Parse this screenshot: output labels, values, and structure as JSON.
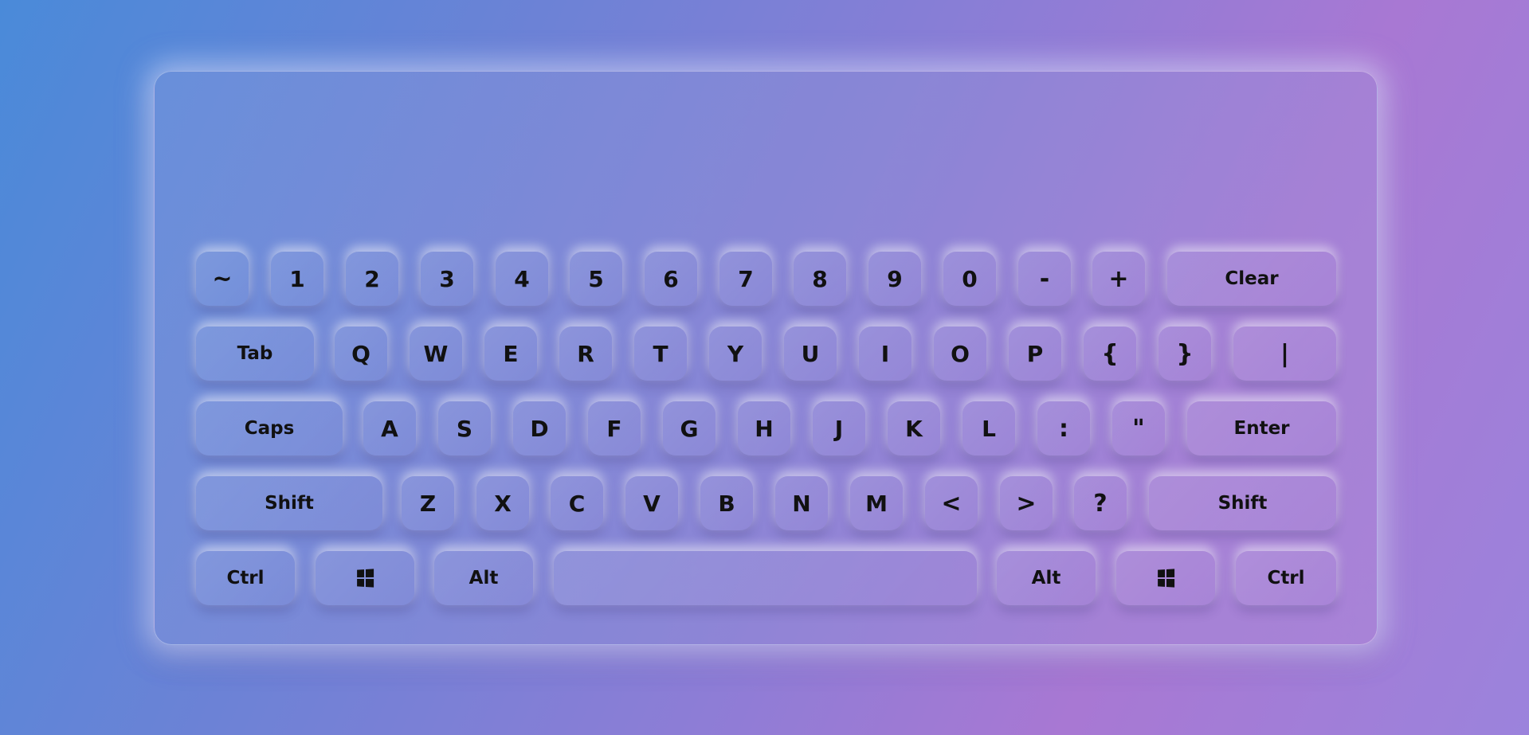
{
  "colors": {
    "background_start": "#4a8ad9",
    "background_end": "#a878d3",
    "key_text": "#111111"
  },
  "display": {
    "value": ""
  },
  "rows": [
    [
      {
        "id": "tilde",
        "label": "~"
      },
      {
        "id": "1",
        "label": "1"
      },
      {
        "id": "2",
        "label": "2"
      },
      {
        "id": "3",
        "label": "3"
      },
      {
        "id": "4",
        "label": "4"
      },
      {
        "id": "5",
        "label": "5"
      },
      {
        "id": "6",
        "label": "6"
      },
      {
        "id": "7",
        "label": "7"
      },
      {
        "id": "8",
        "label": "8"
      },
      {
        "id": "9",
        "label": "9"
      },
      {
        "id": "0",
        "label": "0"
      },
      {
        "id": "minus",
        "label": "-"
      },
      {
        "id": "plus",
        "label": "+"
      },
      {
        "id": "clear",
        "label": "Clear"
      }
    ],
    [
      {
        "id": "tab",
        "label": "Tab"
      },
      {
        "id": "q",
        "label": "Q"
      },
      {
        "id": "w",
        "label": "W"
      },
      {
        "id": "e",
        "label": "E"
      },
      {
        "id": "r",
        "label": "R"
      },
      {
        "id": "t",
        "label": "T"
      },
      {
        "id": "y",
        "label": "Y"
      },
      {
        "id": "u",
        "label": "U"
      },
      {
        "id": "i",
        "label": "I"
      },
      {
        "id": "o",
        "label": "O"
      },
      {
        "id": "p",
        "label": "P"
      },
      {
        "id": "left-brace",
        "label": "{"
      },
      {
        "id": "right-brace",
        "label": "}"
      },
      {
        "id": "pipe",
        "label": "|"
      }
    ],
    [
      {
        "id": "caps",
        "label": "Caps"
      },
      {
        "id": "a",
        "label": "A"
      },
      {
        "id": "s",
        "label": "S"
      },
      {
        "id": "d",
        "label": "D"
      },
      {
        "id": "f",
        "label": "F"
      },
      {
        "id": "g",
        "label": "G"
      },
      {
        "id": "h",
        "label": "H"
      },
      {
        "id": "j",
        "label": "J"
      },
      {
        "id": "k",
        "label": "K"
      },
      {
        "id": "l",
        "label": "L"
      },
      {
        "id": "colon",
        "label": ":"
      },
      {
        "id": "quote",
        "label": "\""
      },
      {
        "id": "enter",
        "label": "Enter"
      }
    ],
    [
      {
        "id": "shift-left",
        "label": "Shift"
      },
      {
        "id": "z",
        "label": "Z"
      },
      {
        "id": "x",
        "label": "X"
      },
      {
        "id": "c",
        "label": "C"
      },
      {
        "id": "v",
        "label": "V"
      },
      {
        "id": "b",
        "label": "B"
      },
      {
        "id": "n",
        "label": "N"
      },
      {
        "id": "m",
        "label": "M"
      },
      {
        "id": "less-than",
        "label": "<"
      },
      {
        "id": "greater-than",
        "label": ">"
      },
      {
        "id": "question",
        "label": "?"
      },
      {
        "id": "shift-right",
        "label": "Shift"
      }
    ],
    [
      {
        "id": "ctrl-left",
        "label": "Ctrl"
      },
      {
        "id": "win-left",
        "icon": "windows-icon"
      },
      {
        "id": "alt-left",
        "label": "Alt"
      },
      {
        "id": "space",
        "label": ""
      },
      {
        "id": "alt-right",
        "label": "Alt"
      },
      {
        "id": "win-right",
        "icon": "windows-icon"
      },
      {
        "id": "ctrl-right",
        "label": "Ctrl"
      }
    ]
  ]
}
